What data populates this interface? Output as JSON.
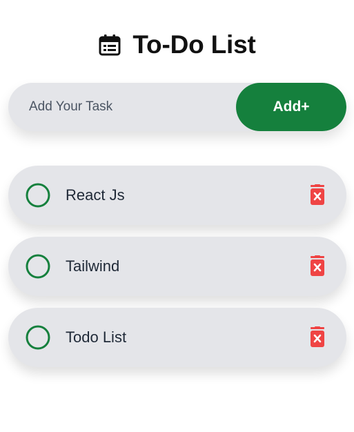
{
  "header": {
    "title": "To-Do List",
    "icon": "calendar-list-icon"
  },
  "input": {
    "placeholder": "Add Your Task",
    "value": ""
  },
  "add_button": {
    "label": "Add+"
  },
  "todos": [
    {
      "text": "React Js",
      "done": false
    },
    {
      "text": "Tailwind",
      "done": false
    },
    {
      "text": "Todo List",
      "done": false
    }
  ],
  "colors": {
    "accent": "#15803d",
    "item_bg": "#e4e5e9",
    "delete": "#ef4444"
  }
}
